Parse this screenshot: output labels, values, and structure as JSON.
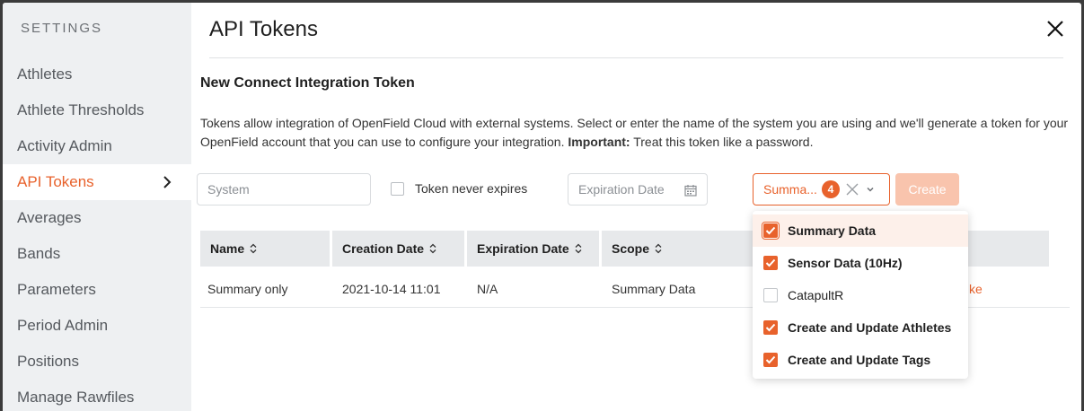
{
  "sidebar": {
    "title": "SETTINGS",
    "items": [
      {
        "label": "Athletes"
      },
      {
        "label": "Athlete Thresholds"
      },
      {
        "label": "Activity Admin"
      },
      {
        "label": "API Tokens"
      },
      {
        "label": "Averages"
      },
      {
        "label": "Bands"
      },
      {
        "label": "Parameters"
      },
      {
        "label": "Period Admin"
      },
      {
        "label": "Positions"
      },
      {
        "label": "Manage Rawfiles"
      }
    ],
    "active_index": 3
  },
  "header": {
    "title": "API Tokens",
    "close_icon": "close-icon"
  },
  "form": {
    "section_title": "New Connect Integration Token",
    "description_start": "Tokens allow integration of OpenField Cloud with external systems. Select or enter the name of the system you are using and we'll generate a token for your OpenField account that you can use to configure your integration. ",
    "description_important": "Important:",
    "description_end": " Treat this token like a password.",
    "system_placeholder": "System",
    "never_expires_label": "Token never expires",
    "expiration_placeholder": "Expiration Date",
    "scope_value": "Summa...",
    "scope_count": "4",
    "create_label": "Create"
  },
  "table": {
    "columns": [
      "Name",
      "Creation Date",
      "Expiration Date",
      "Scope"
    ],
    "rows": [
      {
        "name": "Summary only",
        "created": "2021-10-14 11:01",
        "expires": "N/A",
        "scope": "Summary Data",
        "action": "ke"
      }
    ]
  },
  "scope_dropdown": {
    "options": [
      {
        "label": "Summary Data",
        "checked": true,
        "highlighted": true
      },
      {
        "label": "Sensor Data (10Hz)",
        "checked": true,
        "highlighted": false
      },
      {
        "label": "CatapultR",
        "checked": false,
        "highlighted": false
      },
      {
        "label": "Create and Update Athletes",
        "checked": true,
        "highlighted": false
      },
      {
        "label": "Create and Update Tags",
        "checked": true,
        "highlighted": false
      }
    ]
  },
  "colors": {
    "accent": "#e8622c",
    "sidebar_bg": "#eef0f2",
    "header_cell_bg": "#e7e9eb"
  }
}
